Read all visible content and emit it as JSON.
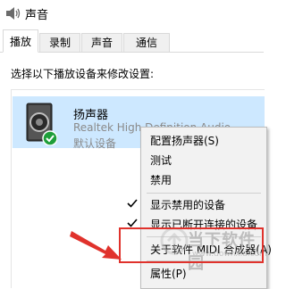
{
  "window": {
    "title": "声音"
  },
  "tabs": [
    {
      "label": "播放",
      "active": true
    },
    {
      "label": "录制",
      "active": false
    },
    {
      "label": "声音",
      "active": false
    },
    {
      "label": "通信",
      "active": false
    }
  ],
  "instruction": "选择以下播放设备来修改设置:",
  "device": {
    "name": "扬声器",
    "driver": "Realtek High Definition Audio",
    "status": "默认设备",
    "icon": "speaker-icon",
    "default_badge": "green-check-icon"
  },
  "context_menu": {
    "items": [
      {
        "label": "配置扬声器(S)",
        "checked": false
      },
      {
        "label": "测试",
        "checked": false
      },
      {
        "label": "禁用",
        "checked": false
      },
      {
        "label": "显示禁用的设备",
        "checked": true
      },
      {
        "label": "显示已断开连接的设备",
        "checked": true
      },
      {
        "label": "关于软件 MIDI 合成器(A)",
        "checked": false
      },
      {
        "label": "属性(P)",
        "checked": false
      }
    ]
  },
  "watermark": {
    "text": "当下软件园",
    "url": "www.downxia.com"
  },
  "colors": {
    "selection": "#cde8ff",
    "highlight_box": "#e0322c",
    "arrow": "#e0322c"
  }
}
